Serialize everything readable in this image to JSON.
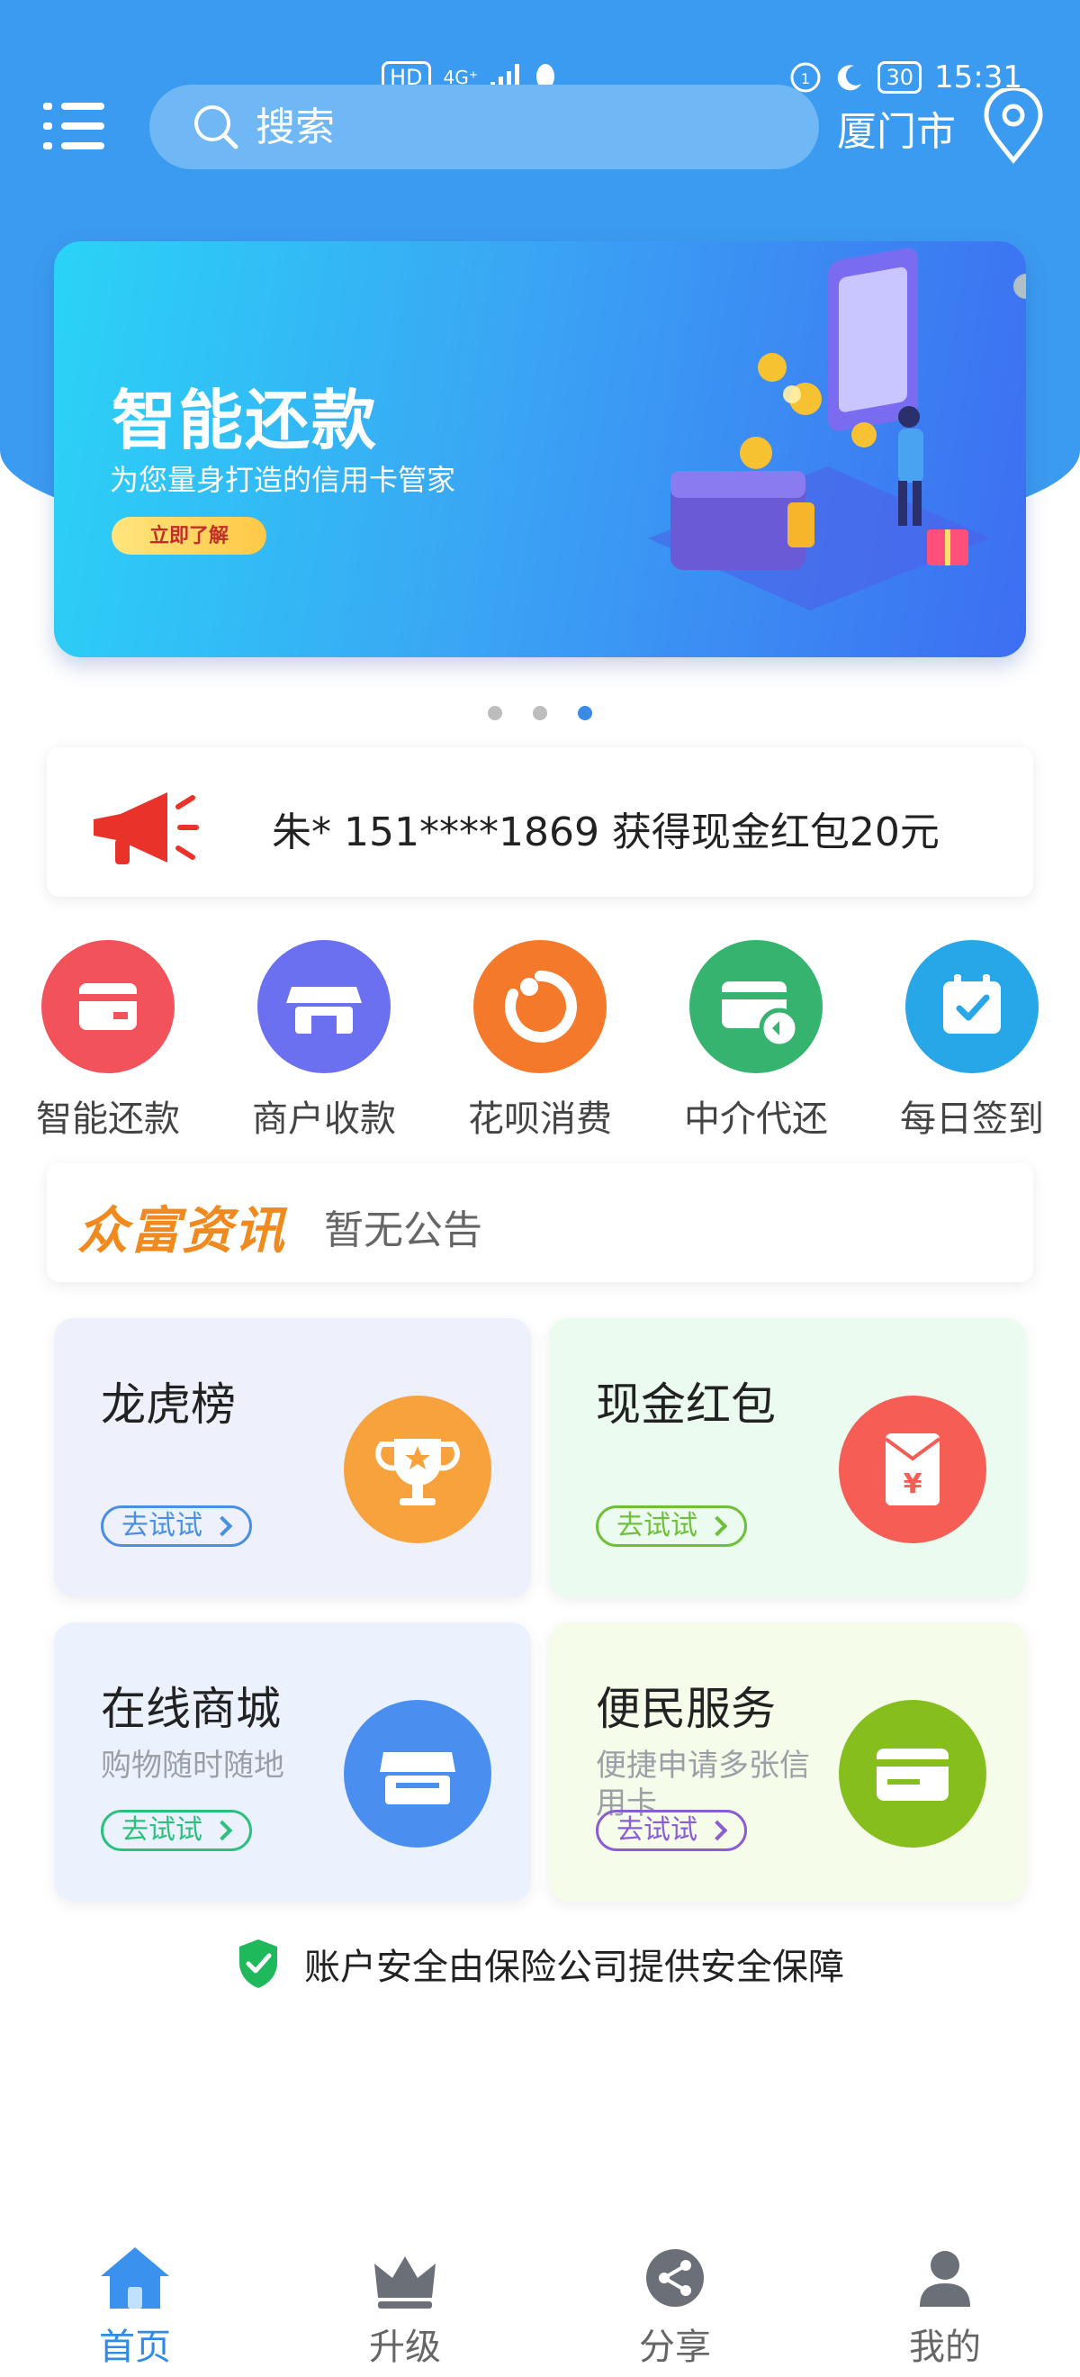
{
  "status_bar": {
    "left_badge": "HD",
    "network": "4G⁺",
    "battery": "30",
    "time": "15:31"
  },
  "header": {
    "search_placeholder": "搜索",
    "city": "厦门市"
  },
  "banner": {
    "title": "智能还款",
    "subtitle": "为您量身打造的信用卡管家",
    "button": "立即了解",
    "page_count": 3,
    "active_page": 3
  },
  "notice": {
    "text": "朱*  151****1869  获得现金红包20元"
  },
  "quick_actions": [
    {
      "label": "智能还款",
      "icon": "card-icon",
      "color": "#f2525a"
    },
    {
      "label": "商户收款",
      "icon": "store-icon",
      "color": "#6b70f0"
    },
    {
      "label": "花呗消费",
      "icon": "huabei-icon",
      "color": "#f5792a"
    },
    {
      "label": "中介代还",
      "icon": "card-refresh-icon",
      "color": "#36b46f"
    },
    {
      "label": "每日签到",
      "icon": "calendar-check-icon",
      "color": "#27a6e8"
    }
  ],
  "news": {
    "logo": "众富资讯",
    "text": "暂无公告"
  },
  "cards": [
    {
      "title": "龙虎榜",
      "subtitle": "",
      "button": "去试试",
      "icon": "trophy-icon",
      "bg": "#eef1fb",
      "accent": "#4a90e2",
      "circle": "#f7a23c"
    },
    {
      "title": "现金红包",
      "subtitle": "",
      "button": "去试试",
      "icon": "red-envelope-icon",
      "bg": "#ecfbef",
      "accent": "#6fbf3a",
      "circle": "#f55d55"
    },
    {
      "title": "在线商城",
      "subtitle": "购物随时随地",
      "button": "去试试",
      "icon": "shop-icon",
      "bg": "#ebf2fd",
      "accent": "#2cc07c",
      "circle": "#4a8ff0"
    },
    {
      "title": "便民服务",
      "subtitle": "便捷申请多张信用卡",
      "button": "去试试",
      "icon": "credit-card-icon",
      "bg": "#f6fcea",
      "accent": "#8a5cd6",
      "circle": "#86be1e"
    }
  ],
  "safety": {
    "text": "账户安全由保险公司提供安全保障"
  },
  "tabs": [
    {
      "label": "首页",
      "icon": "home-icon",
      "active": true
    },
    {
      "label": "升级",
      "icon": "crown-icon",
      "active": false
    },
    {
      "label": "分享",
      "icon": "share-icon",
      "active": false
    },
    {
      "label": "我的",
      "icon": "user-icon",
      "active": false
    }
  ]
}
